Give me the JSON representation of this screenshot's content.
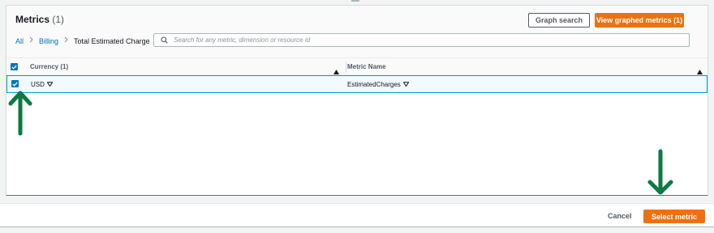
{
  "metrics": {
    "title": "Metrics",
    "count": "(1)",
    "graph_search_label": "Graph search",
    "view_graphed_label": "View graphed metrics (1)"
  },
  "breadcrumb": {
    "items": [
      "All",
      "Billing",
      "Total Estimated Charge"
    ]
  },
  "search": {
    "placeholder": "Search for any metric, dimension or resource id"
  },
  "table": {
    "columns": [
      {
        "label": "Currency",
        "count": "(1)"
      },
      {
        "label": "Metric Name",
        "count": ""
      }
    ],
    "rows": [
      {
        "selected": true,
        "currency": "USD",
        "metric_name": "EstimatedCharges"
      }
    ]
  },
  "footer": {
    "cancel_label": "Cancel",
    "select_label": "Select metric"
  },
  "colors": {
    "accent": "#ec7211",
    "link": "#0073bb",
    "arrow": "#0b7a3e",
    "selected_row_border": "#00a1c9"
  },
  "icons": [
    "search-icon",
    "sort-up-icon",
    "caret-down-icon",
    "check-icon",
    "arrow-up-annotation",
    "arrow-down-annotation"
  ]
}
